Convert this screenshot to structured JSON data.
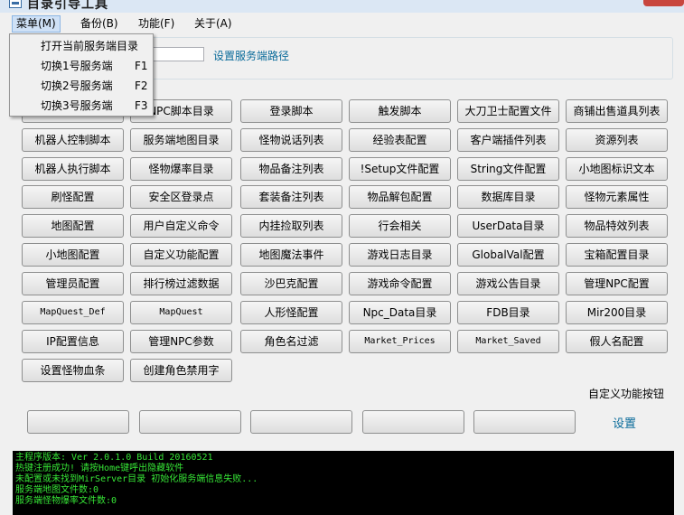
{
  "window": {
    "title": "目录引导工具"
  },
  "menubar": [
    {
      "label": "菜单(M)",
      "active": true
    },
    {
      "label": "备份(B)"
    },
    {
      "label": "功能(F)"
    },
    {
      "label": "关于(A)"
    }
  ],
  "dropdown": [
    {
      "label": "打开当前服务端目录",
      "shortcut": ""
    },
    {
      "label": "切换1号服务端",
      "shortcut": "F1"
    },
    {
      "label": "切换2号服务端",
      "shortcut": "F2"
    },
    {
      "label": "切换3号服务端",
      "shortcut": "F3"
    }
  ],
  "server_path": {
    "link_label": "设置服务端路径",
    "value": ""
  },
  "buttons": [
    [
      "",
      "NPC脚本目录",
      "登录脚本",
      "触发脚本",
      "大刀卫士配置文件",
      "商铺出售道具列表"
    ],
    [
      "机器人控制脚本",
      "服务端地图目录",
      "怪物说话列表",
      "经验表配置",
      "客户端插件列表",
      "资源列表"
    ],
    [
      "机器人执行脚本",
      "怪物爆率目录",
      "物品备注列表",
      "!Setup文件配置",
      "String文件配置",
      "小地图标识文本"
    ],
    [
      "刷怪配置",
      "安全区登录点",
      "套装备注列表",
      "物品解包配置",
      "数据库目录",
      "怪物元素属性"
    ],
    [
      "地图配置",
      "用户自定义命令",
      "内挂捡取列表",
      "行会相关",
      "UserData目录",
      "物品特效列表"
    ],
    [
      "小地图配置",
      "自定义功能配置",
      "地图魔法事件",
      "游戏日志目录",
      "GlobalVal配置",
      "宝箱配置目录"
    ],
    [
      "管理员配置",
      "排行榜过滤数据",
      "沙巴克配置",
      "游戏命令配置",
      "游戏公告目录",
      "管理NPC配置"
    ],
    [
      "MapQuest_Def",
      "MapQuest",
      "人形怪配置",
      "Npc_Data目录",
      "FDB目录",
      "Mir200目录"
    ],
    [
      "IP配置信息",
      "管理NPC参数",
      "角色名过滤",
      "Market_Prices",
      "Market_Saved",
      "假人名配置"
    ],
    [
      "设置怪物血条",
      "创建角色禁用字"
    ]
  ],
  "custom": {
    "label": "自定义功能按钮",
    "settings_label": "设置",
    "buttons": [
      "",
      "",
      "",
      "",
      ""
    ]
  },
  "console": [
    "主程序版本: Ver 2.0.1.0 Build 20160521",
    "热键注册成功! 请按Home键呼出隐藏软件",
    "未配置或未找到MirServer目录 初始化服务端信息失败...",
    "服务端地图文件数:0",
    "服务端怪物爆率文件数:0"
  ]
}
